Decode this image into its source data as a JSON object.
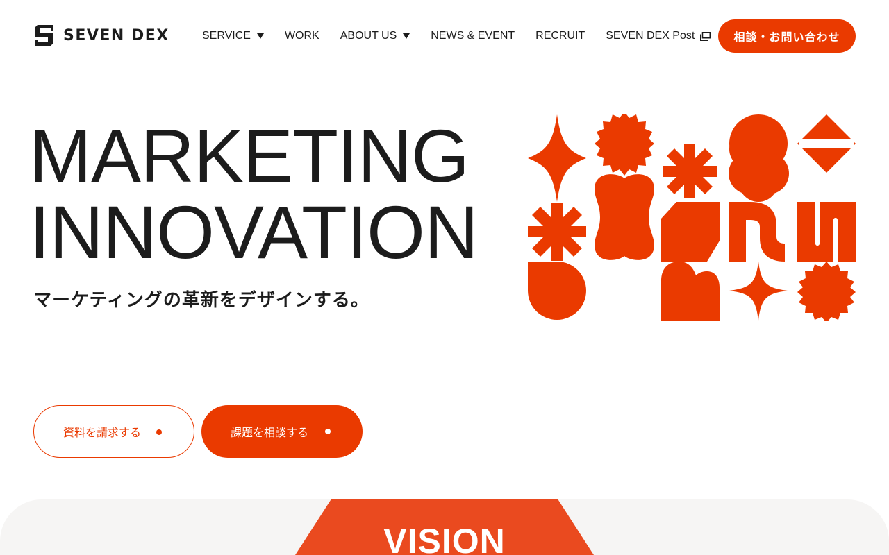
{
  "brand": {
    "name": "SEVEN DEX",
    "accent_color": "#ea3a00"
  },
  "nav": {
    "items": [
      {
        "label": "SERVICE",
        "dropdown": true
      },
      {
        "label": "WORK"
      },
      {
        "label": "ABOUT US",
        "dropdown": true
      },
      {
        "label": "NEWS & EVENT"
      },
      {
        "label": "RECRUIT"
      },
      {
        "label": "SEVEN DEX Post",
        "external": true
      }
    ],
    "cta_label": "相談・お問い合わせ"
  },
  "hero": {
    "title_line1": "MARKETING",
    "title_line2": "INNOVATION",
    "subtitle": "マーケティングの革新をデザインする。",
    "graphic_icon": "abstract-shapes-grid-icon"
  },
  "buttons": {
    "request_docs": "資料を請求する",
    "consult": "課題を相談する"
  },
  "vision": {
    "title": "VISION"
  }
}
